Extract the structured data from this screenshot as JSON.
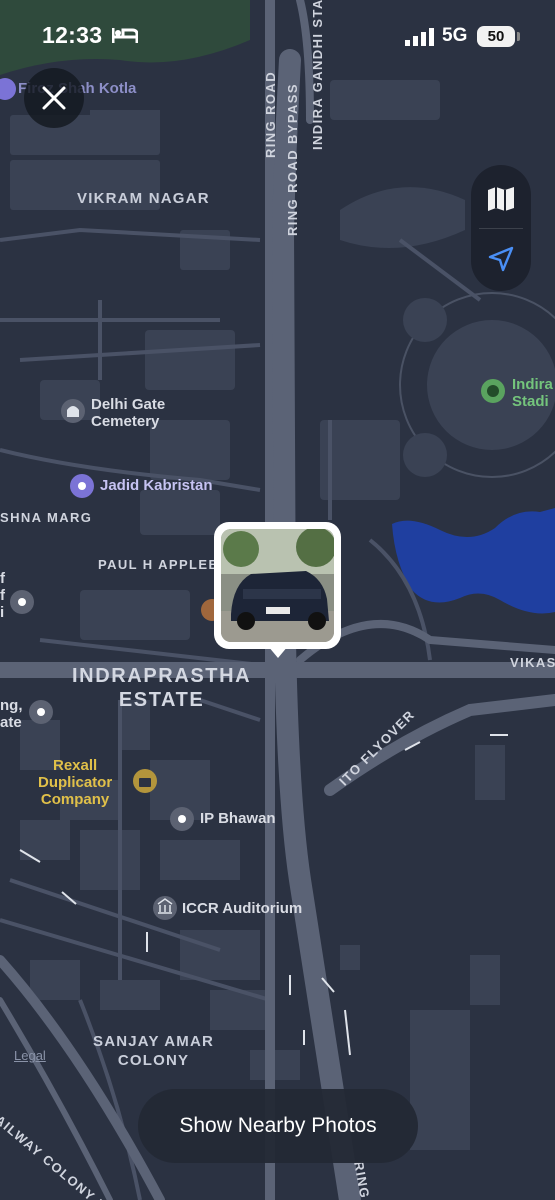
{
  "status_bar": {
    "time": "12:33",
    "network": "5G",
    "battery": "50"
  },
  "poi": {
    "firoz": "Firoz Shah Kotla",
    "delhi_gate": "Delhi Gate\nCemetery",
    "jadid": "Jadid Kabristan",
    "indira": "Indira\nStadi",
    "rexall": "Rexall\nDuplicator\nCompany",
    "ip_bhawan": "IP Bhawan",
    "iccr": "ICCR Auditorium",
    "left_1": "f\nf\ni",
    "left_2": "ng,\nate"
  },
  "areas": {
    "vikram_nagar": "VIKRAM NAGAR",
    "indraprastha": "INDRAPRASTHA\nESTATE",
    "sanjay": "SANJAY AMAR\nCOLONY"
  },
  "roads": {
    "ring_road": "RING ROAD",
    "ring_bypass": "RING ROAD BYPASS",
    "indira_gandhi": "INDIRA GANDHI STADIUM ROAD",
    "appleby": "PAUL H APPLEBY M",
    "shna_marg": "SHNA MARG",
    "vikas": "VIKAS",
    "ito": "ITO FLYOVER",
    "railway": "AILWAY COLONY RO",
    "ring_bottom": "RING"
  },
  "legal": "Legal",
  "nearby_button": "Show Nearby Photos",
  "colors": {
    "background": "#2b3242",
    "blocks": "#3a4254",
    "roads": "#5b6376",
    "water": "#1f3fa0",
    "park": "#2f4a3c"
  },
  "icons": [
    "close-icon",
    "map-icon",
    "location-arrow-icon",
    "bed-icon",
    "signal-icon",
    "pin-icon",
    "cemetery-icon",
    "stadium-icon",
    "briefcase-icon",
    "museum-icon"
  ]
}
